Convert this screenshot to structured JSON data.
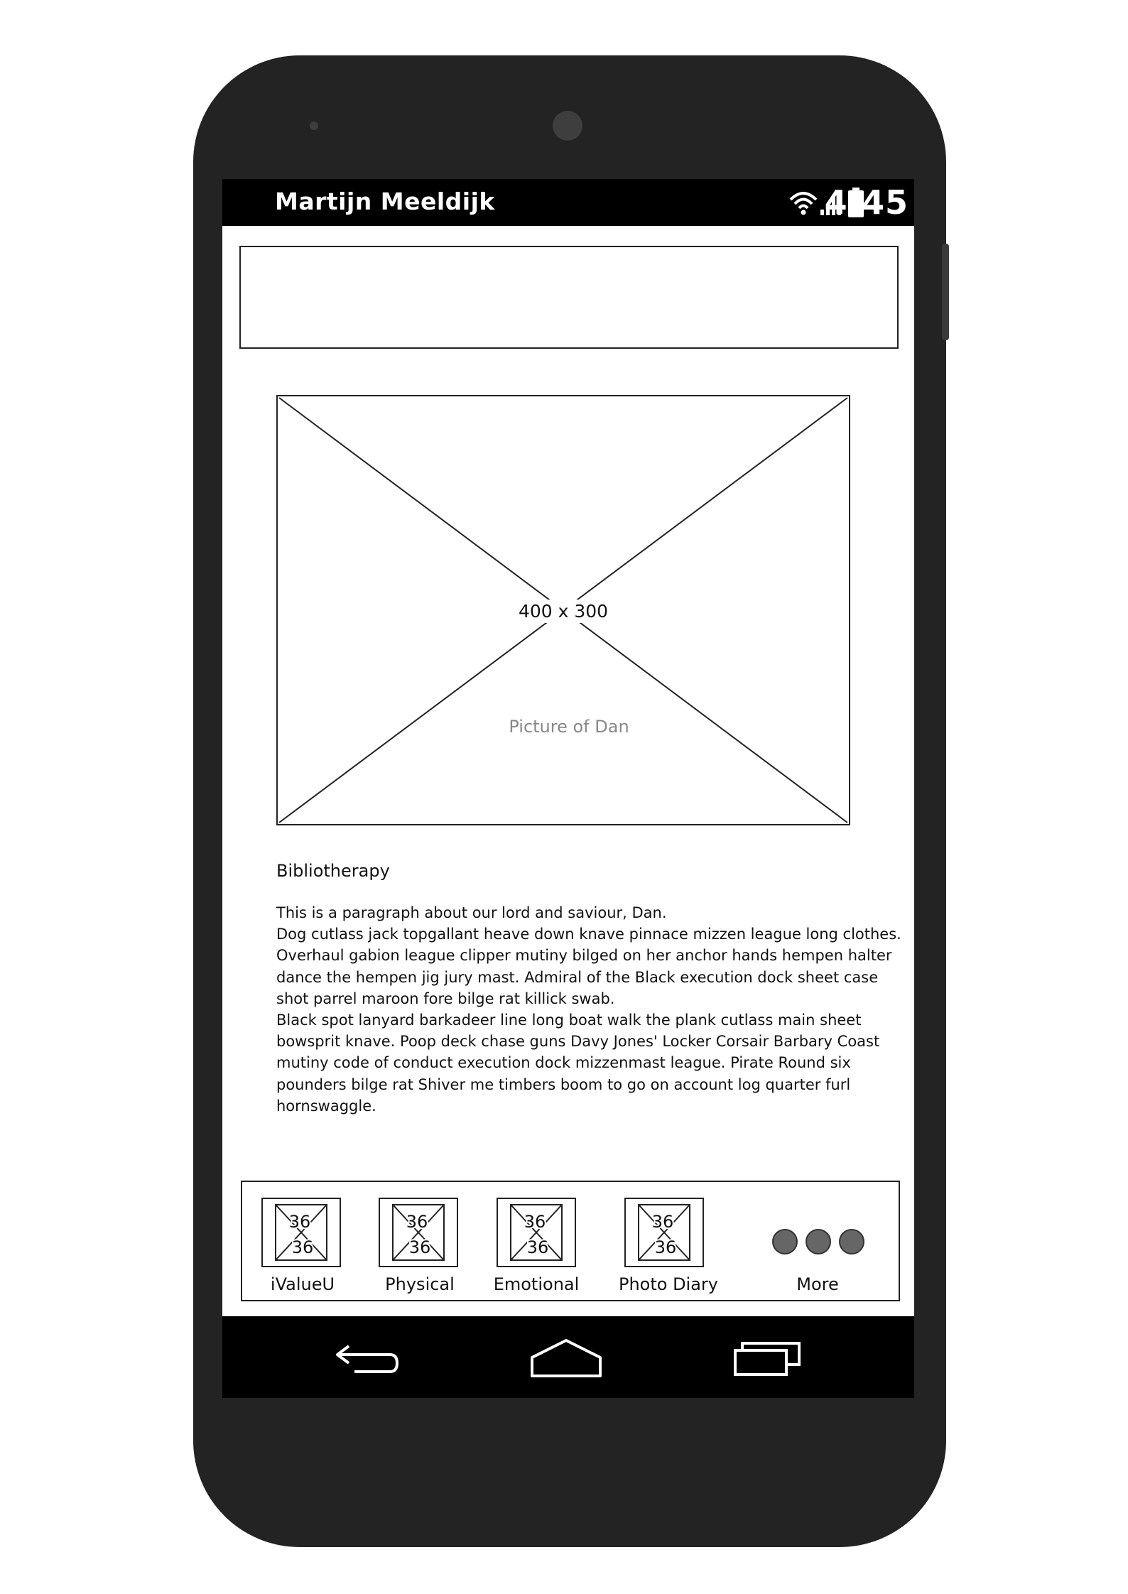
{
  "status_bar": {
    "title": "Martijn Meeldijk",
    "time": "4:45",
    "icons": [
      "wifi-icon",
      "signal-icon",
      "battery-icon"
    ]
  },
  "image_placeholder": {
    "size_label": "400 x 300",
    "caption": "Picture of Dan"
  },
  "content": {
    "heading": "Bibliotherapy",
    "paragraph_lines": [
      "This is a paragraph about our lord and saviour, Dan.",
      "Dog cutlass jack topgallant heave down knave pinnace mizzen league long clothes.",
      "Overhaul gabion league clipper mutiny bilged on her anchor hands hempen halter",
      "dance the hempen jig jury mast. Admiral of the Black execution dock sheet case",
      "shot parrel maroon fore bilge rat killick swab.",
      "Black spot lanyard barkadeer line long boat walk the plank cutlass main sheet",
      "bowsprit knave. Poop deck chase guns Davy Jones' Locker Corsair Barbary Coast",
      "mutiny code of conduct execution dock mizzenmast league. Pirate Round six",
      "pounders bilge rat Shiver me timbers boom to go on account log quarter furl",
      "hornswaggle."
    ]
  },
  "bottom_nav": {
    "icon_placeholder_text": "36",
    "items": [
      {
        "label": "iValueU"
      },
      {
        "label": "Physical"
      },
      {
        "label": "Emotional"
      },
      {
        "label": "Photo Diary"
      },
      {
        "label": "More"
      }
    ]
  },
  "system_nav": {
    "icons": [
      "back-icon",
      "home-icon",
      "recents-icon"
    ]
  }
}
